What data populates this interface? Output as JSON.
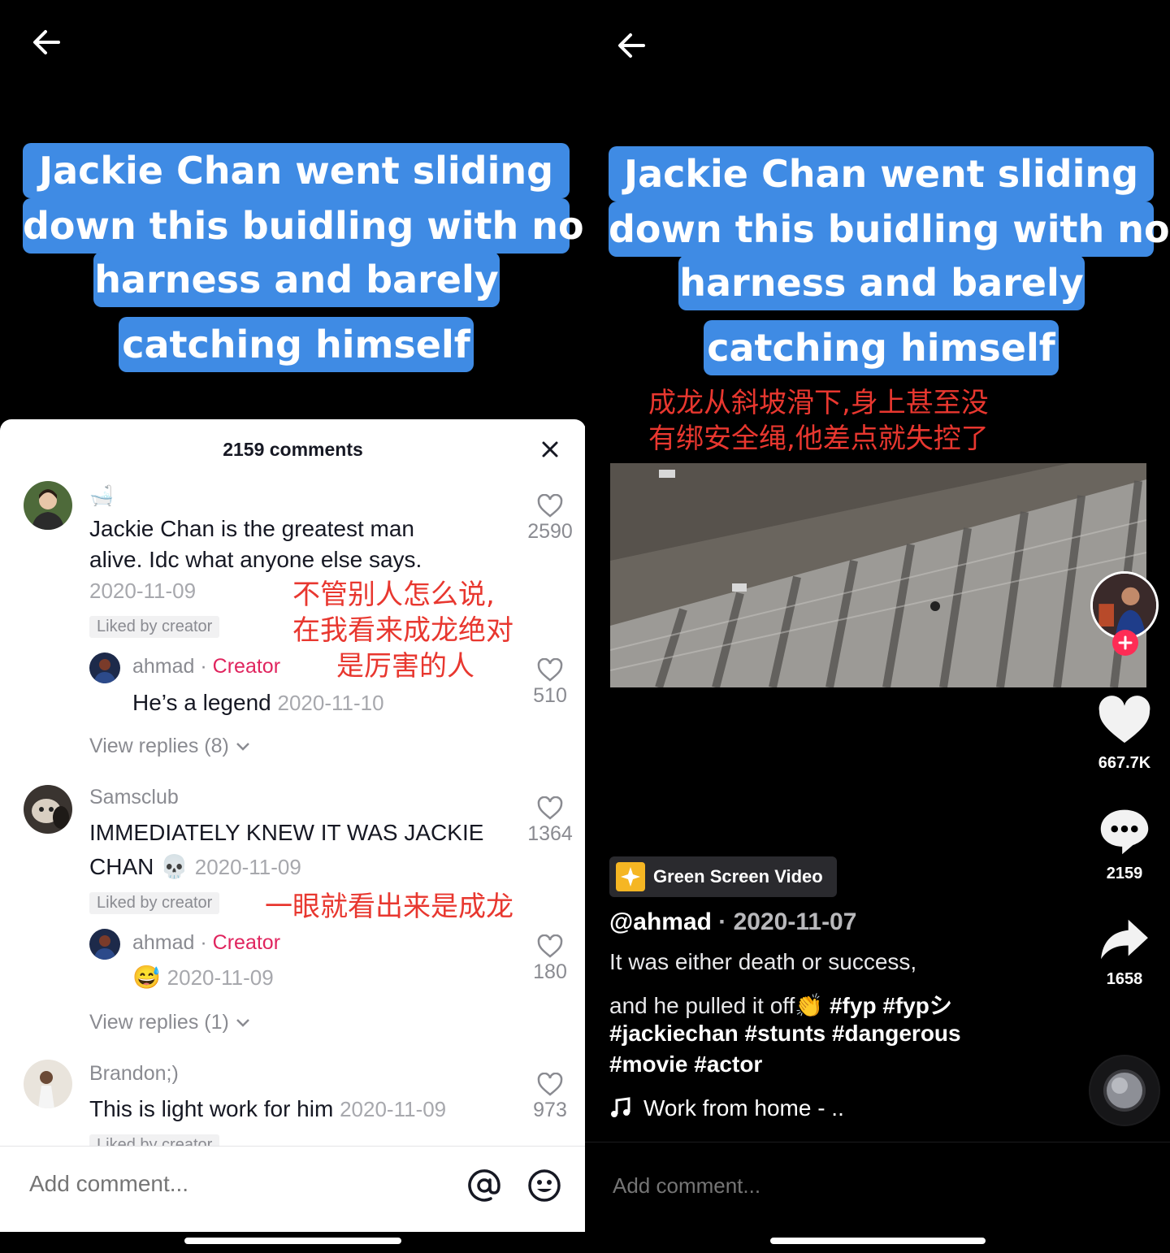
{
  "caption_lines": [
    "Jackie Chan went sliding",
    "down this buidling with no",
    "harness and barely",
    "catching himself"
  ],
  "comments_sheet": {
    "title": "2159 comments",
    "comments": [
      {
        "username": "🛁",
        "text_line1": "Jackie Chan is the greatest man",
        "text_line2": "alive. Idc what anyone else says.",
        "date": "2020-11-09",
        "liked": "Liked by creator",
        "likes": "2590",
        "note": [
          "不管别人怎么说,",
          "在我看来成龙绝对",
          "是厉害的人"
        ],
        "reply": {
          "username": "ahmad",
          "sep": " · ",
          "badge": "Creator",
          "text": "He’s a legend",
          "date": "2020-11-10",
          "likes": "510"
        },
        "view_replies": "View replies (8)"
      },
      {
        "username": "Samsclub",
        "text_line1": "IMMEDIATELY KNEW IT WAS JACKIE",
        "text_line2": "CHAN 💀",
        "date": "2020-11-09",
        "liked": "Liked by creator",
        "likes": "1364",
        "note": [
          "一眼就看出来是成龙"
        ],
        "reply": {
          "username": "ahmad",
          "sep": " · ",
          "badge": "Creator",
          "text": "😅",
          "date": "2020-11-09",
          "likes": "180"
        },
        "view_replies": "View replies (1)"
      },
      {
        "username": "Brandon;)",
        "text_line1": "This is light work for him",
        "date": "2020-11-09",
        "liked": "Liked by creator",
        "likes": "973"
      }
    ],
    "add_placeholder": "Add comment..."
  },
  "video_screen": {
    "cn_caption": [
      "成龙从斜坡滑下,身上甚至没",
      "有绑安全绳,他差点就失控了"
    ],
    "likes": "667.7K",
    "comments": "2159",
    "shares": "1658",
    "effect_badge": "Green Screen Video",
    "author": "@ahmad",
    "author_sep": " · ",
    "post_date": "2020-11-07",
    "desc_line1": "It was either death or success,",
    "desc_line2": "and he pulled it off👏",
    "desc_tags_inline": " #fyp #fypシ",
    "tags_line1": "#jackiechan #stunts #dangerous",
    "tags_line2": "#movie #actor",
    "music": "Work from home - ..",
    "add_placeholder": "Add comment..."
  },
  "colors": {
    "caption_bg": "#3f8be4",
    "creator": "#e0245e",
    "annotation": "#e8372f",
    "follow_plus": "#fe2c55"
  },
  "icons": [
    "back-arrow-icon",
    "close-icon",
    "heart-outline-icon",
    "chevron-down-icon",
    "at-icon",
    "emoji-icon",
    "heart-icon",
    "comment-bubble-icon",
    "share-arrow-icon",
    "music-note-icon",
    "sparkle-icon",
    "plus-icon"
  ]
}
